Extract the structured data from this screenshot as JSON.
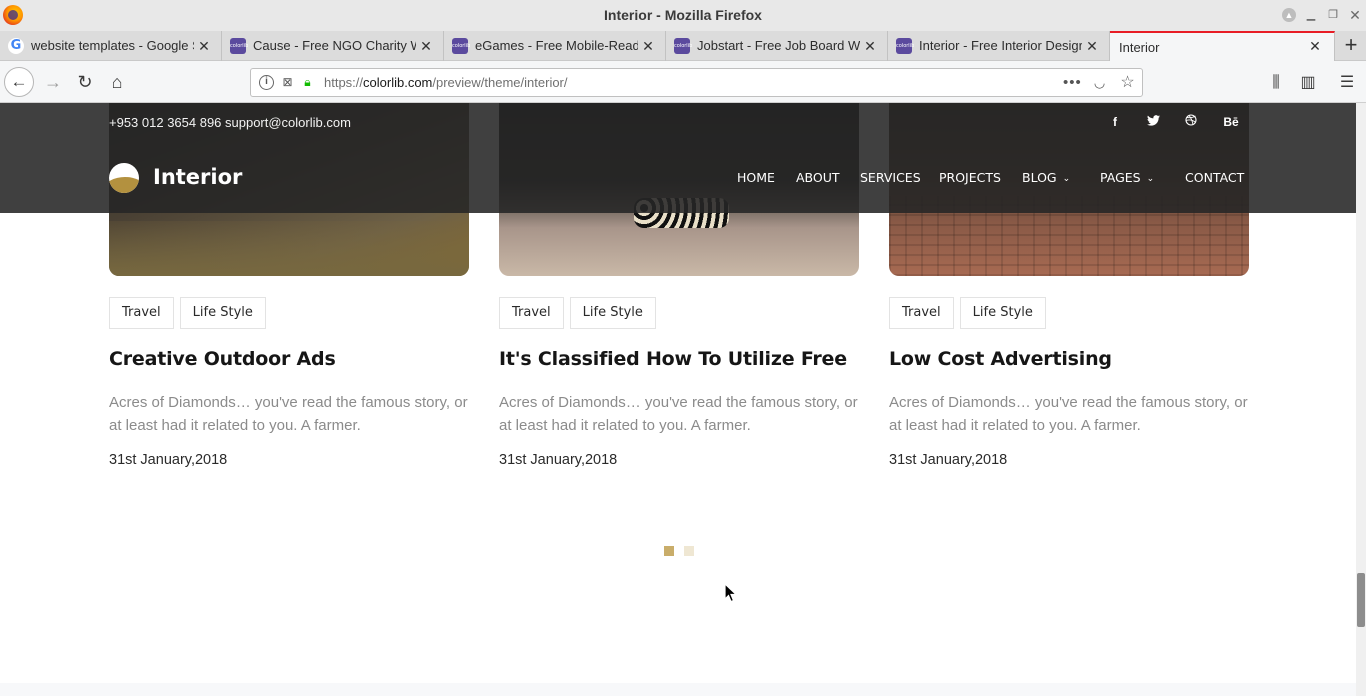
{
  "window": {
    "title": "Interior - Mozilla Firefox"
  },
  "tabs": [
    {
      "label": "website templates - Google S",
      "favicon": "google-icon"
    },
    {
      "label": "Cause - Free NGO Charity We",
      "favicon": "colorlib-icon"
    },
    {
      "label": "eGames - Free Mobile-Ready",
      "favicon": "colorlib-icon"
    },
    {
      "label": "Jobstart - Free Job Board Wel",
      "favicon": "colorlib-icon"
    },
    {
      "label": "Interior - Free Interior Desigr",
      "favicon": "colorlib-icon"
    },
    {
      "label": "Interior",
      "active": true
    }
  ],
  "favicon_text": {
    "google": "G",
    "colorlib": "colorlib"
  },
  "urlbar": {
    "prefix": "https://",
    "domain": "colorlib.com",
    "path": "/preview/theme/interior/"
  },
  "site": {
    "phone": "+953 012 3654 896",
    "email": "support@colorlib.com",
    "logo_text": "Interior",
    "social": {
      "facebook": "f",
      "behance": "Bē"
    },
    "nav": {
      "home": "HOME",
      "about": "ABOUT",
      "services": "SERVICES",
      "projects": "PROJECTS",
      "blog": "BLOG",
      "pages": "PAGES",
      "contact": "CONTACT"
    }
  },
  "posts": [
    {
      "tags": [
        "Travel",
        "Life Style"
      ],
      "title": "Creative Outdoor Ads",
      "excerpt": "Acres of Diamonds… you've read the famous story, or at least had it related to you. A farmer.",
      "date": "31st January,2018"
    },
    {
      "tags": [
        "Travel",
        "Life Style"
      ],
      "title": "It's Classified How To Utilize Free",
      "excerpt": "Acres of Diamonds… you've read the famous story, or at least had it related to you. A farmer.",
      "date": "31st January,2018"
    },
    {
      "tags": [
        "Travel",
        "Life Style"
      ],
      "title": "Low Cost Advertising",
      "excerpt": "Acres of Diamonds… you've read the famous story, or at least had it related to you. A farmer.",
      "date": "31st January,2018"
    }
  ],
  "carousel": {
    "active_index": 0,
    "count": 2
  },
  "colors": {
    "accent": "#c9ad6a",
    "accent_light": "#efe7d3",
    "header_bg": "#262626",
    "tab_active_border": "#e81d26"
  }
}
